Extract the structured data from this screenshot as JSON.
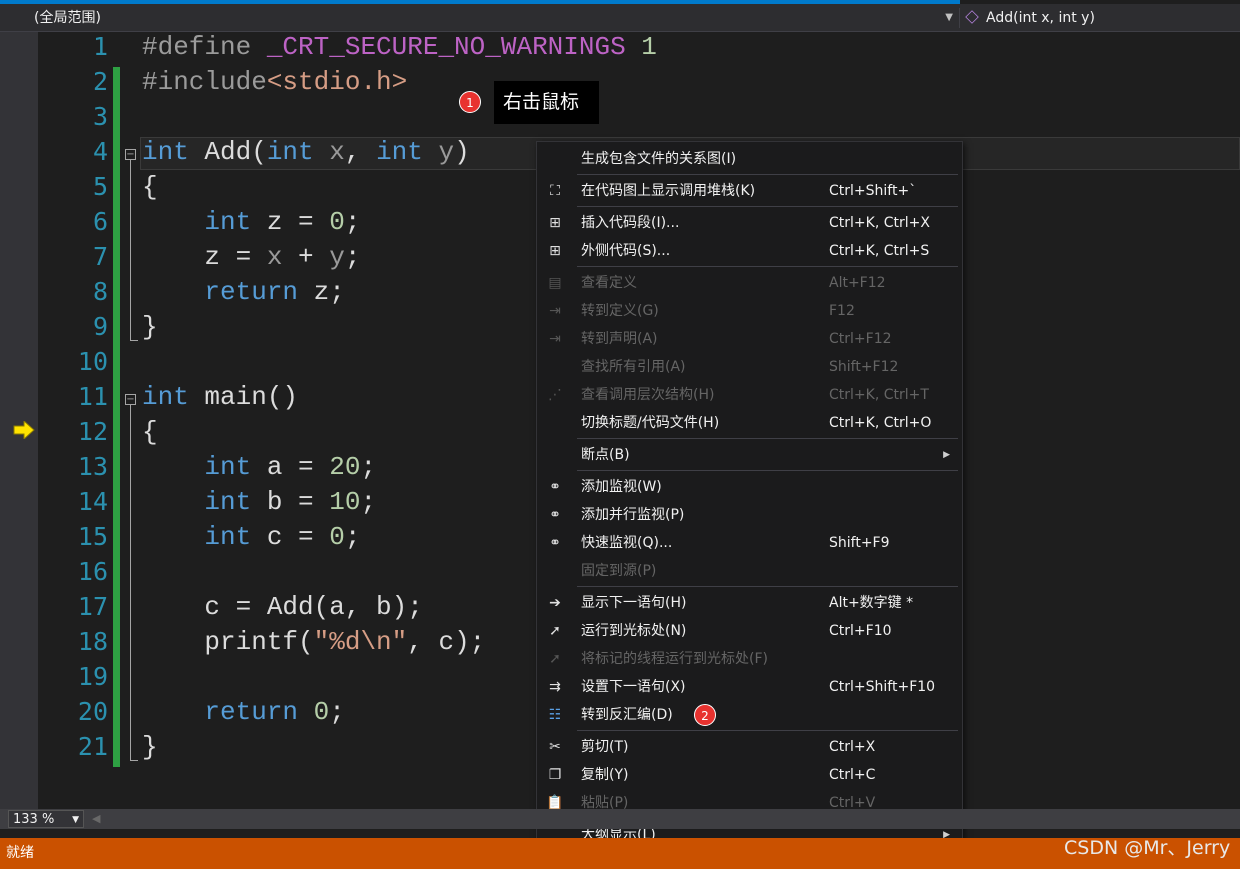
{
  "navbar": {
    "scope": "(全局范围)",
    "member": "Add(int x, int y)"
  },
  "editor": {
    "line_numbers": [
      "1",
      "2",
      "3",
      "4",
      "5",
      "6",
      "7",
      "8",
      "9",
      "10",
      "11",
      "12",
      "13",
      "14",
      "15",
      "16",
      "17",
      "18",
      "19",
      "20",
      "21"
    ],
    "current_statement_line": "12"
  },
  "annotations": {
    "step1_badge": "1",
    "step1_text": "右击鼠标",
    "step2_badge": "2"
  },
  "context_menu": {
    "items": [
      {
        "label": "生成包含文件的关系图(I)",
        "shortcut": "",
        "icon": "none-icon",
        "enabled": true
      },
      {
        "label": "在代码图上显示调用堆栈(K)",
        "shortcut": "Ctrl+Shift+`",
        "icon": "code-map-icon",
        "enabled": true
      },
      {
        "label": "插入代码段(I)...",
        "shortcut": "Ctrl+K, Ctrl+X",
        "icon": "snippet-insert-icon",
        "enabled": true
      },
      {
        "label": "外侧代码(S)...",
        "shortcut": "Ctrl+K, Ctrl+S",
        "icon": "surround-with-icon",
        "enabled": true
      },
      {
        "label": "查看定义",
        "shortcut": "Alt+F12",
        "icon": "peek-definition-icon",
        "enabled": false
      },
      {
        "label": "转到定义(G)",
        "shortcut": "F12",
        "icon": "go-to-definition-icon",
        "enabled": false
      },
      {
        "label": "转到声明(A)",
        "shortcut": "Ctrl+F12",
        "icon": "go-to-declaration-icon",
        "enabled": false
      },
      {
        "label": "查找所有引用(A)",
        "shortcut": "Shift+F12",
        "icon": "none-icon",
        "enabled": false
      },
      {
        "label": "查看调用层次结构(H)",
        "shortcut": "Ctrl+K, Ctrl+T",
        "icon": "call-hierarchy-icon",
        "enabled": false
      },
      {
        "label": "切换标题/代码文件(H)",
        "shortcut": "Ctrl+K, Ctrl+O",
        "icon": "none-icon",
        "enabled": true
      },
      {
        "label": "断点(B)",
        "shortcut": "",
        "icon": "none-icon",
        "enabled": true,
        "submenu": true
      },
      {
        "label": "添加监视(W)",
        "shortcut": "",
        "icon": "watch-glasses-icon",
        "enabled": true
      },
      {
        "label": "添加并行监视(P)",
        "shortcut": "",
        "icon": "watch-glasses-icon",
        "enabled": true
      },
      {
        "label": "快速监视(Q)...",
        "shortcut": "Shift+F9",
        "icon": "watch-glasses-icon",
        "enabled": true
      },
      {
        "label": "固定到源(P)",
        "shortcut": "",
        "icon": "none-icon",
        "enabled": false
      },
      {
        "label": "显示下一语句(H)",
        "shortcut": "Alt+数字键 *",
        "icon": "arrow-right-icon",
        "enabled": true
      },
      {
        "label": "运行到光标处(N)",
        "shortcut": "Ctrl+F10",
        "icon": "cursor-icon",
        "enabled": true
      },
      {
        "label": "将标记的线程运行到光标处(F)",
        "shortcut": "",
        "icon": "cursor-icon",
        "enabled": false
      },
      {
        "label": "设置下一语句(X)",
        "shortcut": "Ctrl+Shift+F10",
        "icon": "set-next-statement-icon",
        "enabled": true
      },
      {
        "label": "转到反汇编(D)",
        "shortcut": "",
        "icon": "disassembly-icon",
        "enabled": true
      },
      {
        "label": "剪切(T)",
        "shortcut": "Ctrl+X",
        "icon": "scissors-icon",
        "enabled": true
      },
      {
        "label": "复制(Y)",
        "shortcut": "Ctrl+C",
        "icon": "copy-icon",
        "enabled": true
      },
      {
        "label": "粘贴(P)",
        "shortcut": "Ctrl+V",
        "icon": "paste-icon",
        "enabled": false
      },
      {
        "label": "大纲显示(L)",
        "shortcut": "",
        "icon": "none-icon",
        "enabled": true,
        "submenu": true
      }
    ]
  },
  "statusbar": {
    "zoom": "133 %",
    "status": "就绪",
    "watermark": "CSDN @Mr、Jerry"
  },
  "colors": {
    "accent": "#007acc",
    "status_bar": "#ca5100",
    "change_bar": "#2ea043",
    "keyword": "#569cd6",
    "macro": "#bd63c5",
    "badge": "#e8322f"
  }
}
